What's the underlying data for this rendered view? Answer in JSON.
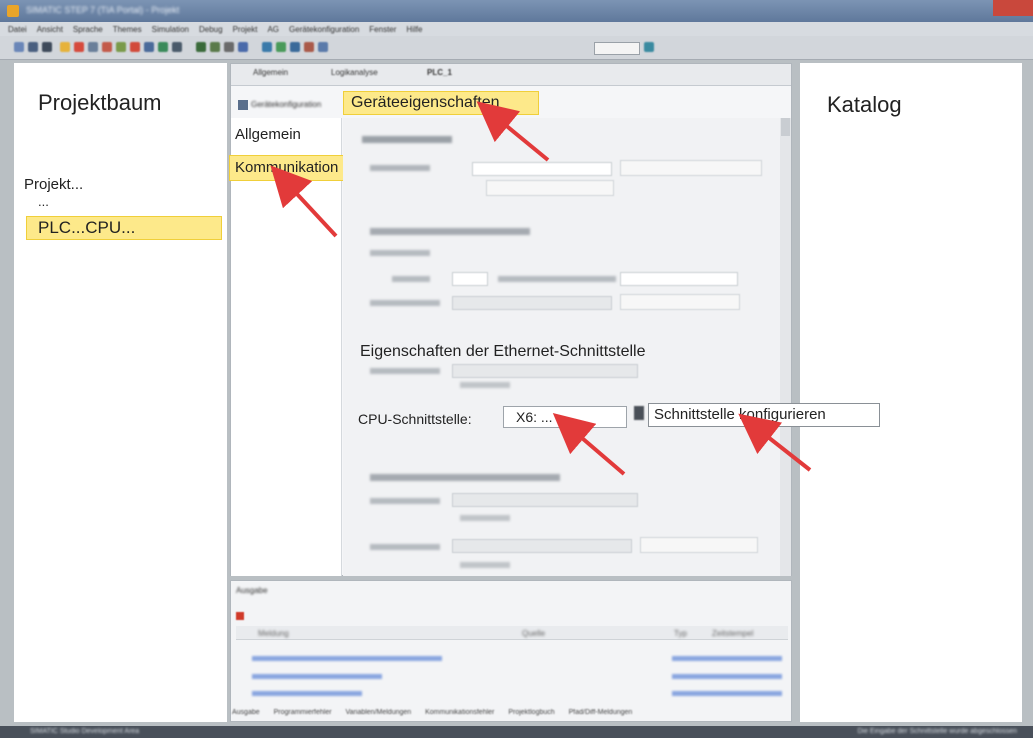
{
  "window": {
    "title": "SIMATIC STEP 7 (TIA Portal) - Projekt",
    "menu": [
      "Datei",
      "Ansicht",
      "Sprache",
      "Themes",
      "Simulation",
      "Debug",
      "Projekt",
      "AG",
      "Gerätekonfiguration",
      "Fenster",
      "Hilfe"
    ]
  },
  "left_panel": {
    "title": "Projektbaum",
    "tree_root": "Projekt...",
    "tree_ellipsis": "...",
    "tree_selected": "PLC...CPU..."
  },
  "right_panel": {
    "title": "Katalog"
  },
  "center": {
    "tabs": [
      "Allgemein",
      "Logikanalyse",
      "PLC_1"
    ],
    "subtab": "Gerätekonfiguration",
    "subtab_highlight": "Geräteeigenschaften",
    "nav": {
      "allgemein": "Allgemein",
      "kommunikation": "Kommunikation"
    },
    "section_ethernet": "Eigenschaften der Ethernet-Schnittstelle",
    "cpu_interface_label": "CPU-Schnittstelle:",
    "cpu_interface_value": "X6: ...",
    "configure_button": "Schnittstelle konfigurieren"
  },
  "output": {
    "title": "Ausgabe",
    "columns": [
      "Meldung",
      "Quelle",
      "Typ",
      "Zeitstempel"
    ],
    "tabs": [
      "Ausgabe",
      "Programmierfehler",
      "Variablen/Meldungen",
      "Kommunikationsfehler",
      "Projektlogbuch",
      "Pfad/Diff-Meldungen"
    ]
  },
  "statusbar": {
    "left": "SIMATIC Studio Development Area",
    "right": "Die Eingabe der Schnittstelle wurde abgeschlossen"
  },
  "colors": {
    "highlight": "#fde98a",
    "arrow": "#e23a3a"
  }
}
